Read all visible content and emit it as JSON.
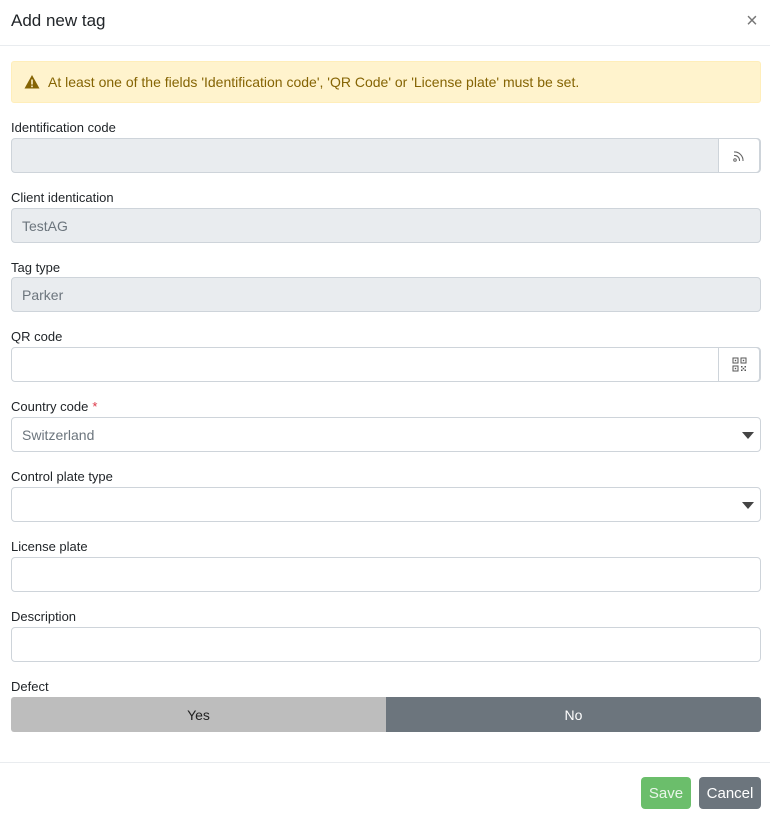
{
  "dialog": {
    "title": "Add new tag",
    "close_glyph": "×"
  },
  "alert": {
    "text": "At least one of the fields 'Identification code', 'QR Code' or 'License plate' must be set.",
    "icon": "warning-icon"
  },
  "fields": {
    "identification_code": {
      "label": "Identification code",
      "value": "",
      "addon_icon": "rfid-scan-icon"
    },
    "client_identification": {
      "label": "Client identication",
      "value": "TestAG"
    },
    "tag_type": {
      "label": "Tag type",
      "value": "Parker"
    },
    "qr_code": {
      "label": "QR code",
      "value": "",
      "addon_icon": "qr-code-icon"
    },
    "country_code": {
      "label": "Country code",
      "required_mark": "*",
      "value": "Switzerland"
    },
    "control_plate_type": {
      "label": "Control plate type",
      "value": ""
    },
    "license_plate": {
      "label": "License plate",
      "value": ""
    },
    "description": {
      "label": "Description",
      "value": ""
    },
    "defect": {
      "label": "Defect",
      "yes": "Yes",
      "no": "No",
      "selected": "No"
    }
  },
  "footer": {
    "save_label": "Save",
    "cancel_label": "Cancel"
  },
  "colors": {
    "alert_bg": "#fff3cd",
    "alert_text": "#856404",
    "save": "#5cb85c",
    "cancel": "#6c757d",
    "required": "#dc3545"
  }
}
